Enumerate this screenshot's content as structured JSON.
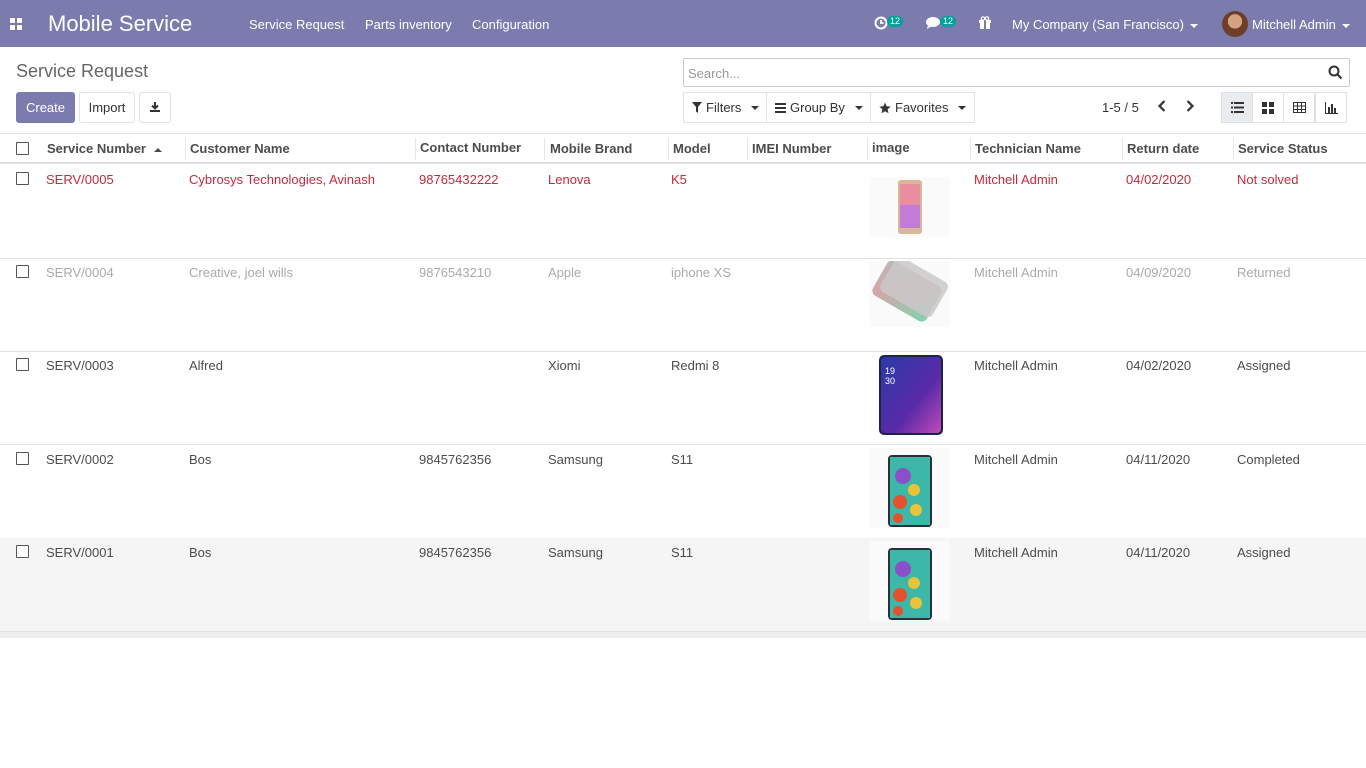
{
  "navbar": {
    "app_title": "Mobile Service",
    "menu": [
      "Service Request",
      "Parts inventory",
      "Configuration"
    ],
    "activity_count": "12",
    "messages_count": "12",
    "company": "My Company (San Francisco)",
    "user": "Mitchell Admin",
    "accent_color": "#7c7bad"
  },
  "control_panel": {
    "title": "Service Request",
    "create_label": "Create",
    "import_label": "Import",
    "search_placeholder": "Search...",
    "filters_label": "Filters",
    "groupby_label": "Group By",
    "favorites_label": "Favorites",
    "pager": "1-5 / 5"
  },
  "table": {
    "columns": [
      "Service Number",
      "Customer Name",
      "Contact Number",
      "Mobile Brand",
      "Model",
      "IMEI Number",
      "image",
      "Technician Name",
      "Return date",
      "Service Status"
    ],
    "rows": [
      {
        "service_number": "SERV/0005",
        "customer": "Cybrosys Technologies, Avinash",
        "contact": "98765432222",
        "brand": "Lenova",
        "model": "K5",
        "imei": "",
        "image": "phone-gold",
        "technician": "Mitchell Admin",
        "return_date": "04/02/2020",
        "status": "Not solved",
        "style": "danger"
      },
      {
        "service_number": "SERV/0004",
        "customer": "Creative, joel wills",
        "contact": "9876543210",
        "brand": "Apple",
        "model": "iphone XS",
        "imei": "",
        "image": "phone-gradient",
        "technician": "Mitchell Admin",
        "return_date": "04/09/2020",
        "status": "Returned",
        "style": "muted"
      },
      {
        "service_number": "SERV/0003",
        "customer": "Alfred",
        "contact": "",
        "brand": "Xiomi",
        "model": "Redmi 8",
        "imei": "",
        "image": "phone-blue",
        "technician": "Mitchell Admin",
        "return_date": "04/02/2020",
        "status": "Assigned",
        "style": "normal"
      },
      {
        "service_number": "SERV/0002",
        "customer": "Bos",
        "contact": "9845762356",
        "brand": "Samsung",
        "model": "S11",
        "imei": "",
        "image": "phone-colorful",
        "technician": "Mitchell Admin",
        "return_date": "04/11/2020",
        "status": "Completed",
        "style": "normal"
      },
      {
        "service_number": "SERV/0001",
        "customer": "Bos",
        "contact": "9845762356",
        "brand": "Samsung",
        "model": "S11",
        "imei": "",
        "image": "phone-colorful",
        "technician": "Mitchell Admin",
        "return_date": "04/11/2020",
        "status": "Assigned",
        "style": "normal"
      }
    ]
  }
}
